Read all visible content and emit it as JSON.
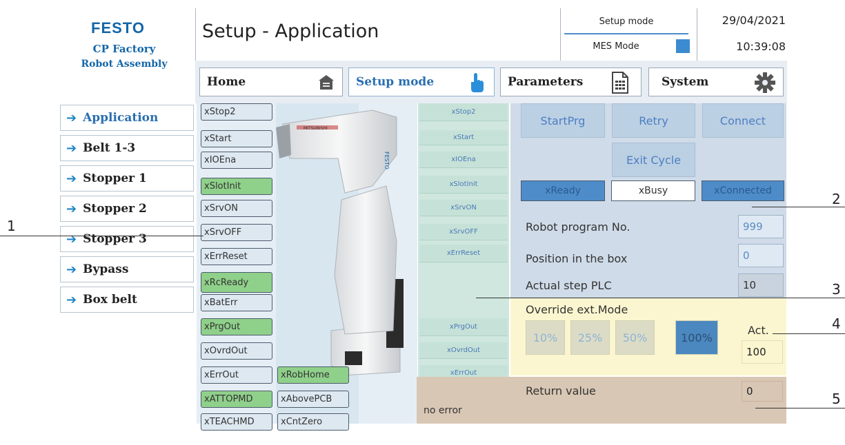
{
  "logo": {
    "brand": "FESTO",
    "line1": "CP Factory",
    "line2": "Robot Assembly"
  },
  "header": {
    "title": "Setup - Application",
    "mode_label": "Setup mode",
    "mes_label": "MES Mode",
    "date": "29/04/2021",
    "time": "10:39:08"
  },
  "topnav": [
    {
      "label": "Home",
      "icon": "home-icon"
    },
    {
      "label": "Setup mode",
      "icon": "pointing-hand-icon"
    },
    {
      "label": "Parameters",
      "icon": "document-icon"
    },
    {
      "label": "System",
      "icon": "gear-icon"
    }
  ],
  "sidebar": {
    "items": [
      {
        "label": "Application"
      },
      {
        "label": "Belt 1-3"
      },
      {
        "label": "Stopper 1"
      },
      {
        "label": "Stopper 2"
      },
      {
        "label": "Stopper 3"
      },
      {
        "label": "Bypass"
      },
      {
        "label": "Box belt"
      }
    ]
  },
  "inputs": [
    {
      "label": "xStop2",
      "on": false
    },
    {
      "label": "xStart",
      "on": false
    },
    {
      "label": "xIOEna",
      "on": false
    },
    {
      "label": "xSlotInit",
      "on": true
    },
    {
      "label": "xSrvON",
      "on": false
    },
    {
      "label": "xSrvOFF",
      "on": false
    },
    {
      "label": "xErrReset",
      "on": false
    },
    {
      "label": "xRcReady",
      "on": true
    },
    {
      "label": "xBatErr",
      "on": false
    },
    {
      "label": "xPrgOut",
      "on": true
    },
    {
      "label": "xOvrdOut",
      "on": false
    },
    {
      "label": "xErrOut",
      "on": false
    },
    {
      "label": "xATTOPMD",
      "on": true
    },
    {
      "label": "xTEACHMD",
      "on": false
    }
  ],
  "inputs2": [
    {
      "label": "xRobHome",
      "on": true
    },
    {
      "label": "xAbovePCB",
      "on": false
    },
    {
      "label": "xCntZero",
      "on": false
    }
  ],
  "outputs": {
    "top": [
      "xStop2",
      "xStart",
      "xIOEna",
      "xSlotInit",
      "xSrvON",
      "xSrvOFF",
      "xErrReset"
    ],
    "bottom": [
      "xPrgOut",
      "xOvrdOut",
      "xErrOut"
    ]
  },
  "panel": {
    "buttons": {
      "start": "StartPrg",
      "retry": "Retry",
      "connect": "Connect",
      "exit": "Exit Cycle"
    },
    "status": {
      "ready": "xReady",
      "busy": "xBusy",
      "connected": "xConnected"
    },
    "fields": [
      {
        "label": "Robot program No.",
        "value": "999"
      },
      {
        "label": "Position in the box",
        "value": "0"
      },
      {
        "label": "Actual step PLC",
        "value": "10"
      }
    ],
    "override": {
      "title": "Override ext.Mode",
      "options": [
        "10%",
        "25%",
        "50%",
        "100%"
      ],
      "selected": "100%",
      "act_label": "Act.",
      "act_value": "100"
    },
    "return_label": "Return value",
    "return_value": "0",
    "message": "no error"
  },
  "callouts": [
    "1",
    "2",
    "3",
    "4",
    "5"
  ],
  "colors": {
    "brand": "#1466a8",
    "active_blue": "#2a6fb1",
    "input_on": "#8fd08a",
    "input_off": "#dde8f1",
    "panel_bg": "#cfdbe8",
    "override_bg": "#fbf6cf",
    "return_bg": "#d8c7b4"
  }
}
